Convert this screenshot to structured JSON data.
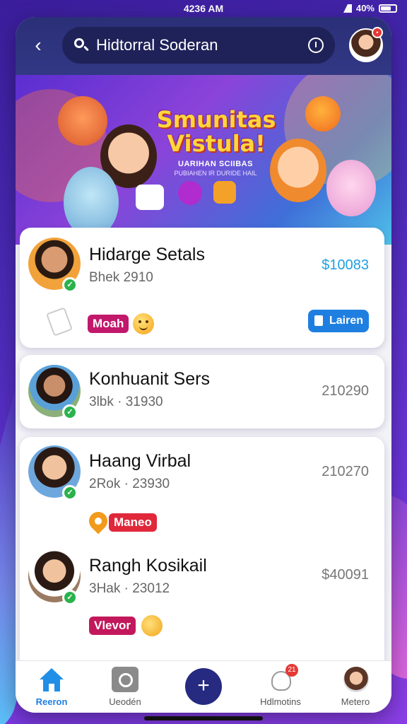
{
  "status": {
    "time": "4236 AM",
    "battery": "40%"
  },
  "search": {
    "query": "Hidtorral Soderan"
  },
  "banner": {
    "title": "Smunitas Vistula!",
    "subtitle": "UARIHAN SCIIBAS",
    "subtitle2": "PUBIAHEN IR DURIDE HAIL"
  },
  "cards": [
    {
      "name": "Hidarge Setals",
      "meta": "Bhek 2910",
      "amount": "$10083",
      "tag": "Moah",
      "tag_color": "#c2186b",
      "action": "Lairen"
    },
    {
      "name": "Konhuanit Sers",
      "meta": "3lbk · 31930",
      "amount": "210290"
    },
    {
      "name": "Haang Virbal",
      "meta": "2Rok · 23930",
      "amount": "210270",
      "tag": "Maneo",
      "tag_color": "#e0283a"
    },
    {
      "name": "Rangh Kosikail",
      "meta": "3Hak · 23012",
      "amount": "$40091",
      "tag": "Vlevor",
      "tag_color": "#c2185b"
    }
  ],
  "nav": [
    {
      "label": "Reeron",
      "icon": "home-icon",
      "active": true
    },
    {
      "label": "Ueodén",
      "icon": "camera-icon"
    },
    {
      "label": "",
      "icon": "add-icon"
    },
    {
      "label": "Hdlmotins",
      "icon": "bell-icon",
      "badge": "21"
    },
    {
      "label": "Metero",
      "icon": "avatar-icon"
    }
  ],
  "colors": {
    "accent": "#1f7fe0",
    "topbar": "#2b2f78",
    "verified": "#2bb24c"
  }
}
